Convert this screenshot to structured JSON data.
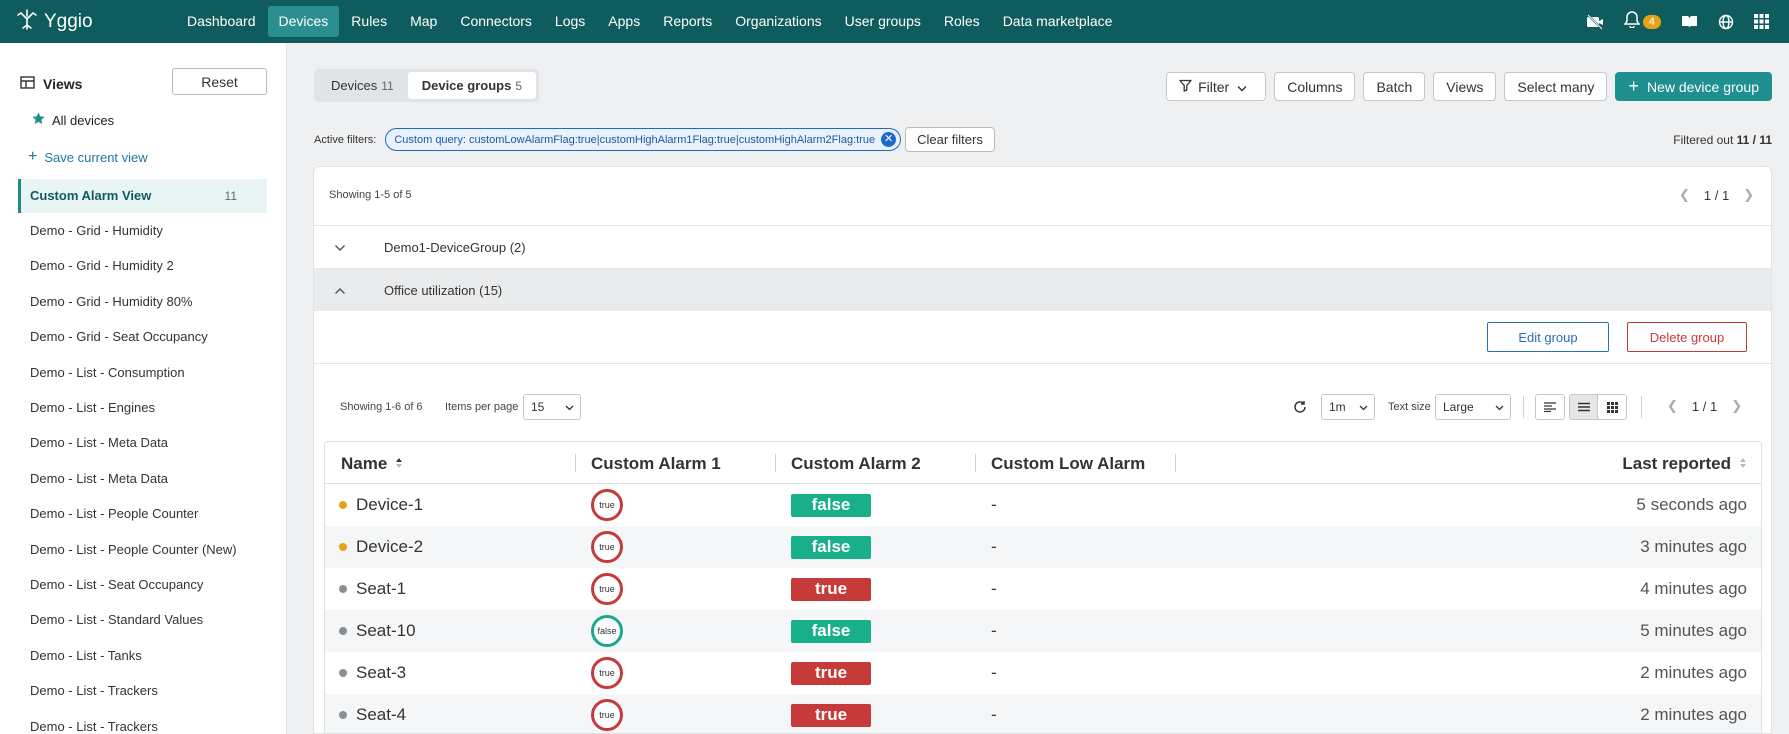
{
  "app": {
    "name": "Yggio"
  },
  "nav": {
    "links": [
      "Dashboard",
      "Devices",
      "Rules",
      "Map",
      "Connectors",
      "Logs",
      "Apps",
      "Reports",
      "Organizations",
      "User groups",
      "Roles",
      "Data marketplace"
    ],
    "active": "Devices",
    "notification_count": "4",
    "icons": [
      "camera-off-icon",
      "bell-icon",
      "book-icon",
      "globe-icon",
      "grid-icon"
    ]
  },
  "sidebar": {
    "title": "Views",
    "reset_label": "Reset",
    "all_devices": "All devices",
    "save_view": "Save current view",
    "active_view": {
      "label": "Custom Alarm View",
      "count": "11"
    },
    "views": [
      "Demo - Grid - Humidity",
      "Demo - Grid - Humidity 2",
      "Demo - Grid - Humidity 80%",
      "Demo - Grid - Seat Occupancy",
      "Demo - List - Consumption",
      "Demo - List - Engines",
      "Demo - List - Meta Data",
      "Demo - List - Meta Data",
      "Demo - List - People Counter",
      "Demo - List - People Counter (New)",
      "Demo - List - Seat Occupancy",
      "Demo - List - Standard Values",
      "Demo - List - Tanks",
      "Demo - List - Trackers",
      "Demo - List - Trackers"
    ]
  },
  "tabs": [
    {
      "label": "Devices",
      "count": "11",
      "active": false
    },
    {
      "label": "Device groups",
      "count": "5",
      "active": true
    }
  ],
  "toolbar": {
    "filter": "Filter",
    "columns": "Columns",
    "batch": "Batch",
    "views": "Views",
    "select_many": "Select many",
    "new_group": "New device group"
  },
  "filters": {
    "label": "Active filters:",
    "chip": "Custom query: customLowAlarmFlag:true|customHighAlarm1Flag:true|customHighAlarm2Flag:true",
    "clear": "Clear filters",
    "filtered_prefix": "Filtered out",
    "filtered_value": "11 / 11"
  },
  "groups": {
    "showing": "Showing 1-5 of 5",
    "pager": "1 / 1",
    "items": [
      {
        "name": "Demo1-DeviceGroup (2)",
        "open": false
      },
      {
        "name": "Office utilization (15)",
        "open": true
      }
    ],
    "edit": "Edit group",
    "delete": "Delete group"
  },
  "devices": {
    "showing": "Showing 1-6 of 6",
    "items_per_page_label": "Items per page",
    "items_per_page": "15",
    "refresh_interval": "1m",
    "text_size_label": "Text size",
    "text_size": "Large",
    "pager": "1 / 1",
    "columns": [
      "Name",
      "Custom Alarm 1",
      "Custom Alarm 2",
      "Custom Low Alarm",
      "Last reported"
    ],
    "rows": [
      {
        "name": "Device-1",
        "status": "#e8a21a",
        "alarm1": "true",
        "alarm2": "false",
        "low": "-",
        "last": "5 seconds ago"
      },
      {
        "name": "Device-2",
        "status": "#e8a21a",
        "alarm1": "true",
        "alarm2": "false",
        "low": "-",
        "last": "3 minutes ago"
      },
      {
        "name": "Seat-1",
        "status": "#8a8f96",
        "alarm1": "true",
        "alarm2": "true",
        "low": "-",
        "last": "4 minutes ago"
      },
      {
        "name": "Seat-10",
        "status": "#8a8f96",
        "alarm1": "false",
        "alarm2": "false",
        "low": "-",
        "last": "5 minutes ago"
      },
      {
        "name": "Seat-3",
        "status": "#8a8f96",
        "alarm1": "true",
        "alarm2": "true",
        "low": "-",
        "last": "2 minutes ago"
      },
      {
        "name": "Seat-4",
        "status": "#8a8f96",
        "alarm1": "true",
        "alarm2": "true",
        "low": "-",
        "last": "2 minutes ago"
      }
    ]
  },
  "colors": {
    "primary": "#0e5c5d",
    "accent": "#1f8f8f",
    "danger": "#c73a3a",
    "ok": "#17b088"
  }
}
